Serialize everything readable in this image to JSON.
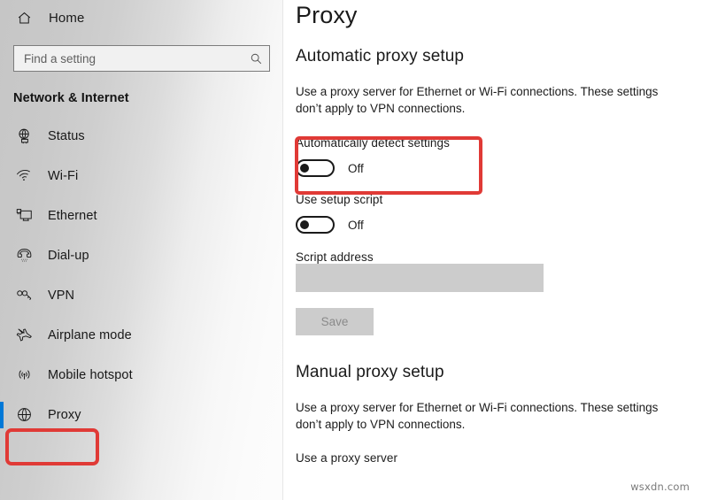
{
  "sidebar": {
    "home": {
      "label": "Home",
      "icon": "home-icon"
    },
    "search": {
      "value": "",
      "placeholder": "Find a setting",
      "icon": "search-icon"
    },
    "category_heading": "Network & Internet",
    "items": [
      {
        "label": "Status",
        "icon": "globe-monitor-icon",
        "selected": false
      },
      {
        "label": "Wi-Fi",
        "icon": "wifi-icon",
        "selected": false
      },
      {
        "label": "Ethernet",
        "icon": "ethernet-monitor-icon",
        "selected": false
      },
      {
        "label": "Dial-up",
        "icon": "telephone-icon",
        "selected": false
      },
      {
        "label": "VPN",
        "icon": "vpn-key-icon",
        "selected": false
      },
      {
        "label": "Airplane mode",
        "icon": "airplane-icon",
        "selected": false
      },
      {
        "label": "Mobile hotspot",
        "icon": "broadcast-icon",
        "selected": false
      },
      {
        "label": "Proxy",
        "icon": "globe-icon",
        "selected": true
      }
    ]
  },
  "main": {
    "title": "Proxy",
    "automatic_section": {
      "heading": "Automatic proxy setup",
      "description": "Use a proxy server for Ethernet or Wi-Fi connections. These settings don’t apply to VPN connections.",
      "auto_detect": {
        "label": "Automatically detect settings",
        "state": "Off",
        "on": false
      },
      "setup_script": {
        "label": "Use setup script",
        "state": "Off",
        "on": false
      },
      "script_address": {
        "label": "Script address",
        "value": "",
        "placeholder": "",
        "disabled": true
      },
      "save_button": {
        "label": "Save",
        "disabled": true
      }
    },
    "manual_section": {
      "heading": "Manual proxy setup",
      "description": "Use a proxy server for Ethernet or Wi-Fi connections. These settings don’t apply to VPN connections.",
      "use_proxy_label": "Use a proxy server"
    }
  },
  "annotations": {
    "highlight_color": "#e03a36",
    "selection_color": "#0078d7",
    "boxes": [
      "automatically-detect-settings",
      "sidebar-item-proxy"
    ]
  },
  "watermark": {
    "text": "wsxdn.com"
  }
}
